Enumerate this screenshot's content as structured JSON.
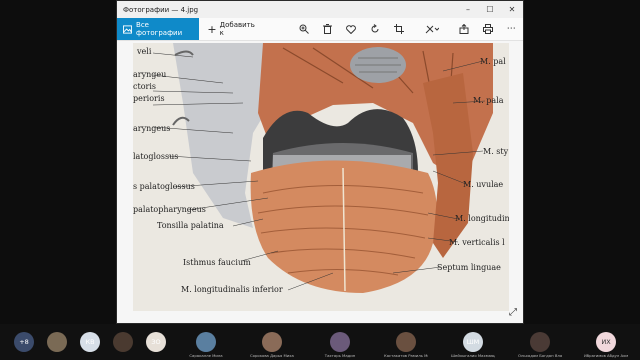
{
  "window": {
    "title": "Фотографии — 4.jpg",
    "minimize": "–",
    "maximize": "☐",
    "close": "✕"
  },
  "toolbar": {
    "all_photos": "Все фотографии",
    "add": "Добавить к",
    "add_icon": "+",
    "icons": [
      "zoom-icon",
      "delete-icon",
      "favorite-icon",
      "rotate-icon",
      "crop-icon",
      "edit-icon",
      "share-icon",
      "print-icon",
      "more-icon"
    ]
  },
  "image_labels": {
    "left": [
      "veli",
      "aryngeu",
      "ctoris",
      "perioris",
      "aryngeus",
      "latoglossus",
      "s palatoglossus",
      "palatopharyngeus",
      "Tonsilla palatina",
      "Isthmus faucium",
      "M. longitudinalis inferior"
    ],
    "right": [
      "M. pal",
      "M. pala",
      "M. sty",
      "M. uvulae",
      "M. longitudin",
      "M. verticalis l",
      "Septum linguae"
    ]
  },
  "participants": [
    {
      "initials": "+8",
      "name": "",
      "color": "#3b4b6b"
    },
    {
      "initials": "",
      "name": "",
      "color": "#7a6a55"
    },
    {
      "initials": "КВ",
      "name": "",
      "color": "#d7dfe8"
    },
    {
      "initials": "",
      "name": "",
      "color": "#4a3a30"
    },
    {
      "initials": "ЗО",
      "name": "",
      "color": "#e7e0d8"
    },
    {
      "initials": "",
      "name": "Саракалле Мила",
      "color": "#5a7fa0"
    },
    {
      "initials": "",
      "name": "Сорокова Дарья Михайловна",
      "color": "#8a6b58"
    },
    {
      "initials": "",
      "name": "Тахтарь Мадин",
      "color": "#6b5a7a"
    },
    {
      "initials": "",
      "name": "Кастакатов Рамиль Менгалиевич",
      "color": "#6a5040"
    },
    {
      "initials": "ШМ",
      "name": "Шейхыгалио Махмаюд",
      "color": "#d3dbe2"
    },
    {
      "initials": "",
      "name": "Ольхадам Богдан Владимирович",
      "color": "#4a3a35"
    },
    {
      "initials": "ИХ",
      "name": "Ибрагимов Абдул Ахмед Рабадиды",
      "color": "#f1d8dc"
    }
  ]
}
